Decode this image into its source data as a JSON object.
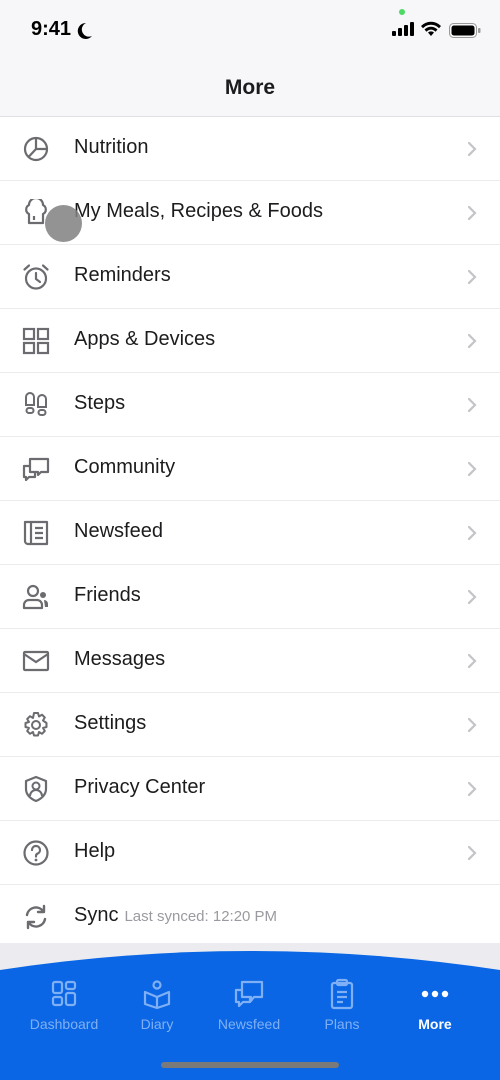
{
  "status_bar": {
    "time": "9:41"
  },
  "header": {
    "title": "More"
  },
  "menu": [
    {
      "label": "Nutrition",
      "icon": "pie-chart-icon"
    },
    {
      "label": "My Meals, Recipes & Foods",
      "icon": "chef-hat-icon"
    },
    {
      "label": "Reminders",
      "icon": "alarm-clock-icon"
    },
    {
      "label": "Apps & Devices",
      "icon": "grid-icon"
    },
    {
      "label": "Steps",
      "icon": "footprints-icon"
    },
    {
      "label": "Community",
      "icon": "chat-bubbles-icon"
    },
    {
      "label": "Newsfeed",
      "icon": "newspaper-icon"
    },
    {
      "label": "Friends",
      "icon": "friends-icon"
    },
    {
      "label": "Messages",
      "icon": "envelope-icon"
    },
    {
      "label": "Settings",
      "icon": "gear-icon"
    },
    {
      "label": "Privacy Center",
      "icon": "shield-user-icon"
    },
    {
      "label": "Help",
      "icon": "question-circle-icon"
    }
  ],
  "sync": {
    "label": "Sync",
    "last_synced": "Last synced: 12:20 PM"
  },
  "tabs": [
    {
      "label": "Dashboard",
      "active": false
    },
    {
      "label": "Diary",
      "active": false
    },
    {
      "label": "Newsfeed",
      "active": false
    },
    {
      "label": "Plans",
      "active": false
    },
    {
      "label": "More",
      "active": true
    }
  ],
  "colors": {
    "brand_blue": "#0a66e4",
    "tab_inactive": "#7fb0f5",
    "icon_grey": "#6b6b70"
  }
}
